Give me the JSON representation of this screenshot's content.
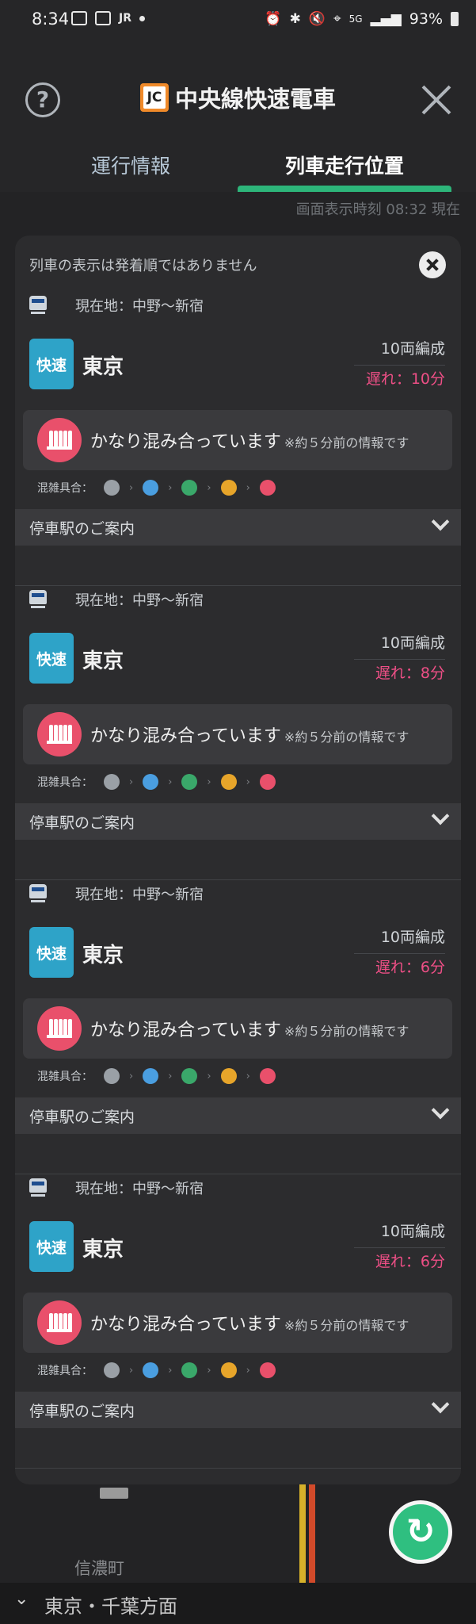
{
  "status_bar": {
    "time": "8:34",
    "carrier": "JR",
    "network": "5G",
    "battery": "93%"
  },
  "header": {
    "line_code": "JC",
    "title": "中央線快速電車",
    "tabs": [
      "運行情報",
      "列車走行位置"
    ],
    "active_tab": 1
  },
  "timestamp": "画面表示時刻 08:32 現在",
  "panel": {
    "notice": "列車の表示は発着順ではありません"
  },
  "trains": [
    {
      "location": "現在地：中野〜新宿",
      "type": "快速",
      "destination": "東京",
      "cars": "10両編成",
      "delay": "遅れ：10分",
      "crowd": "かなり混み合っています",
      "crowd_note": "※約５分前の情報です",
      "crowd_legend_label": "混雑具合：",
      "stops_label": "停車駅のご案内"
    },
    {
      "location": "現在地：中野〜新宿",
      "type": "快速",
      "destination": "東京",
      "cars": "10両編成",
      "delay": "遅れ：8分",
      "crowd": "かなり混み合っています",
      "crowd_note": "※約５分前の情報です",
      "crowd_legend_label": "混雑具合：",
      "stops_label": "停車駅のご案内"
    },
    {
      "location": "現在地：中野〜新宿",
      "type": "快速",
      "destination": "東京",
      "cars": "10両編成",
      "delay": "遅れ：6分",
      "crowd": "かなり混み合っています",
      "crowd_note": "※約５分前の情報です",
      "crowd_legend_label": "混雑具合：",
      "stops_label": "停車駅のご案内"
    },
    {
      "location": "現在地：中野〜新宿",
      "type": "快速",
      "destination": "東京",
      "cars": "10両編成",
      "delay": "遅れ：6分",
      "crowd": "かなり混み合っています",
      "crowd_note": "※約５分前の情報です",
      "crowd_legend_label": "混雑具合：",
      "stops_label": "停車駅のご案内"
    }
  ],
  "crowd_level_colors": [
    "#9aa0a6",
    "#4a9ee0",
    "#3aa86a",
    "#e7a52a",
    "#e9506b"
  ],
  "colors": {
    "accent": "#2db57a",
    "rapid": "#2ea3c8",
    "delay": "#ee4f86",
    "crowd_high": "#e9506b",
    "line_jc": "#f08a2a"
  },
  "map": {
    "station": "信濃町"
  },
  "bottom": {
    "direction": "東京・千葉方面"
  }
}
